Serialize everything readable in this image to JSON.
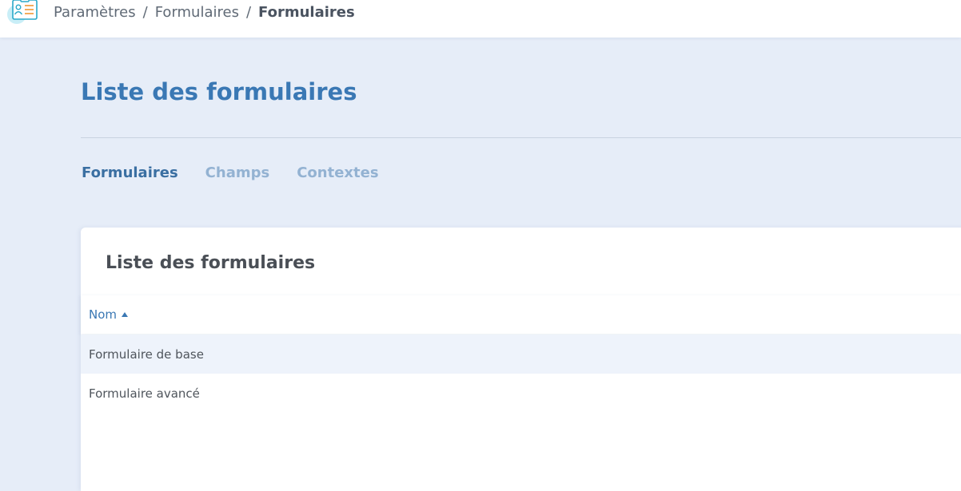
{
  "breadcrumb": {
    "items": [
      "Paramètres",
      "Formulaires"
    ],
    "separator": "/",
    "current": "Formulaires"
  },
  "page": {
    "title": "Liste des formulaires"
  },
  "tabs": [
    {
      "label": "Formulaires",
      "active": true
    },
    {
      "label": "Champs",
      "active": false
    },
    {
      "label": "Contextes",
      "active": false
    }
  ],
  "card": {
    "title": "Liste des formulaires",
    "table": {
      "columns": [
        {
          "label": "Nom",
          "sort": "ascending",
          "sort_icon": "caret-up-icon"
        }
      ],
      "rows": [
        {
          "name": "Formulaire de base"
        },
        {
          "name": "Formulaire avancé"
        }
      ]
    }
  },
  "colors": {
    "background": "#e6edf8",
    "accent": "#3a78b4",
    "tab_inactive": "#93b2d2",
    "row_highlight": "#eef3fb",
    "icon_orange": "#f2a34a",
    "icon_teal": "#2aa9c9"
  }
}
